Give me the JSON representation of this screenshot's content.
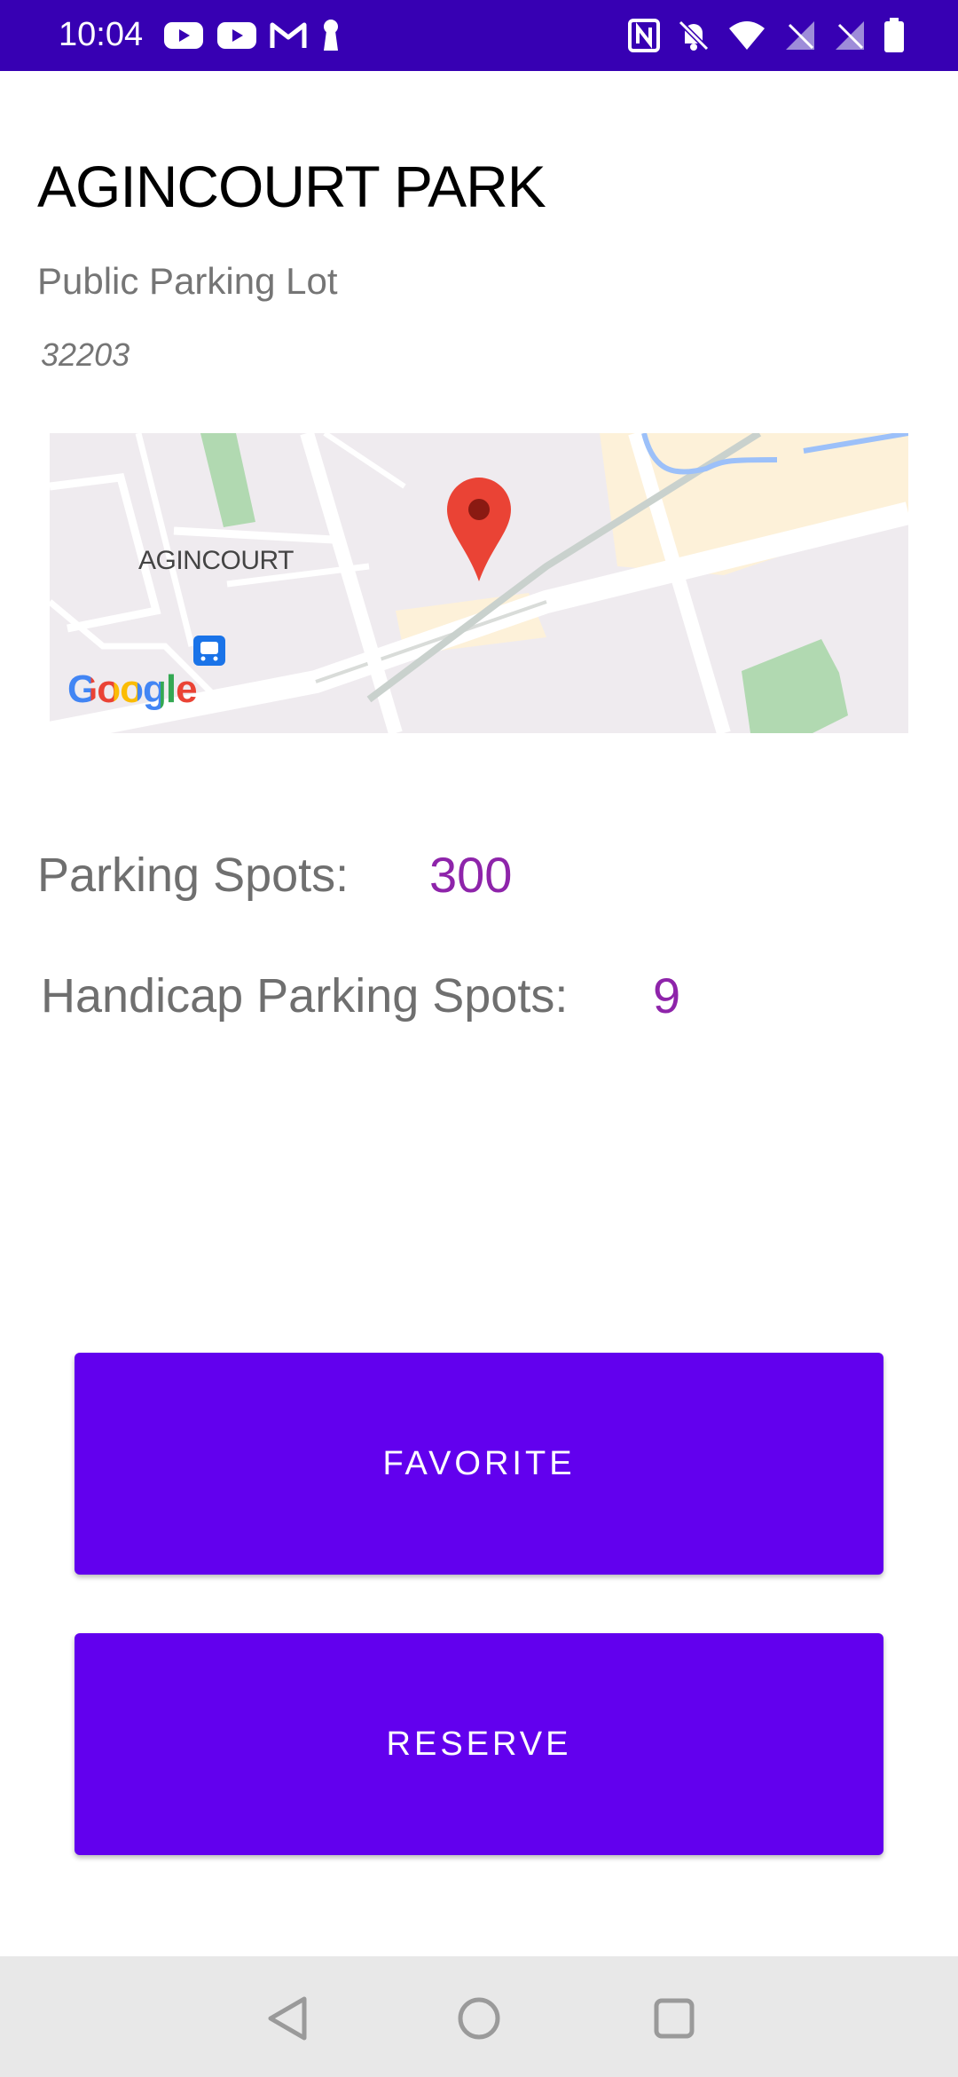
{
  "status_bar": {
    "time": "10:04",
    "left_icons": [
      "youtube-icon",
      "youtube-icon",
      "gmail-icon",
      "keyhole-icon"
    ],
    "right_icons": [
      "nfc-icon",
      "bell-off-icon",
      "wifi-icon",
      "signal-off-icon",
      "signal-off-icon",
      "battery-icon"
    ],
    "background": "#3700b3"
  },
  "lot": {
    "name": "AGINCOURT PARK",
    "type": "Public Parking Lot",
    "zip": "32203"
  },
  "map": {
    "area_label": "AGINCOURT",
    "provider": "Google",
    "marker_icon": "map-pin-icon",
    "transit_icon": "train-icon"
  },
  "details": {
    "parking_spots_label": "Parking Spots:",
    "parking_spots_value": "300",
    "handicap_spots_label": "Handicap Parking Spots:",
    "handicap_spots_value": "9"
  },
  "actions": {
    "favorite_label": "FAVORITE",
    "reserve_label": "RESERVE",
    "button_color": "#6200ee"
  },
  "nav_bar": {
    "icons": [
      "back-icon",
      "home-icon",
      "recents-icon"
    ]
  }
}
